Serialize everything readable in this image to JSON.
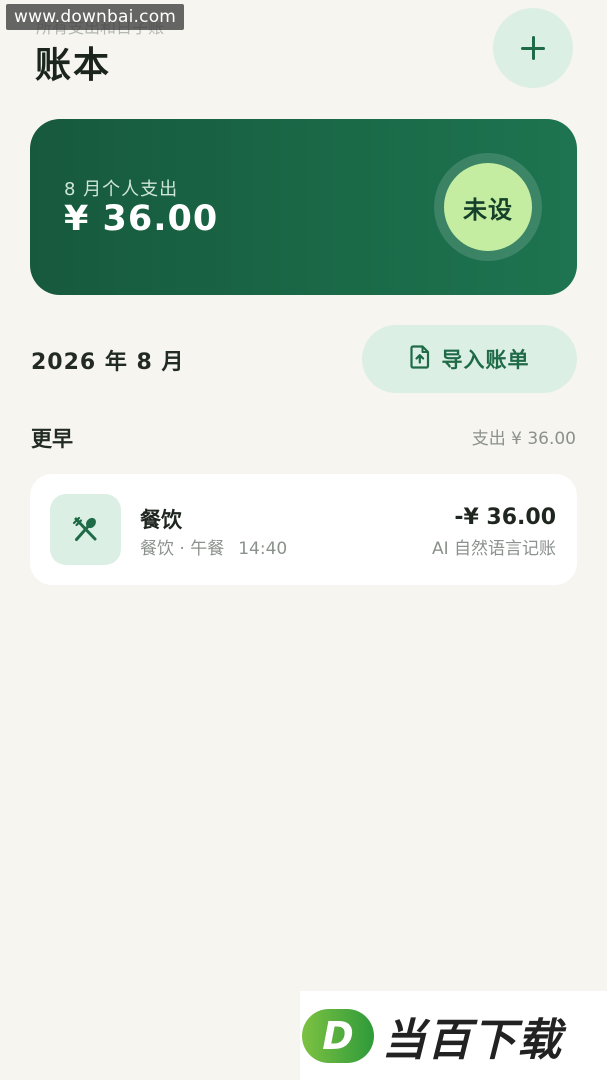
{
  "watermark_top": {
    "text": "www.downbai.com",
    "ghost": "所有支出和日子账"
  },
  "header": {
    "title": "账本",
    "add_icon": "plus-icon"
  },
  "summary": {
    "label": "8 月个人支出",
    "amount": "¥ 36.00",
    "budget_badge": "未设"
  },
  "period": {
    "month_label": "2026 年 8 月",
    "import_button": "导入账单",
    "import_icon": "file-upload-icon"
  },
  "section": {
    "title": "更早",
    "total": "支出 ¥ 36.00"
  },
  "transactions": [
    {
      "icon": "fork-spoon-icon",
      "title": "餐饮",
      "category": "餐饮 · 午餐",
      "time": "14:40",
      "amount": "-¥ 36.00",
      "note": "AI 自然语言记账"
    }
  ],
  "watermark_bottom": {
    "logo_letter": "D",
    "text": "当百下载"
  },
  "colors": {
    "background": "#f6f5f0",
    "card_green": "#1a6a48",
    "accent_green": "#1f6a47",
    "light_green": "#dcefe4",
    "badge_green": "#c4eda1"
  }
}
